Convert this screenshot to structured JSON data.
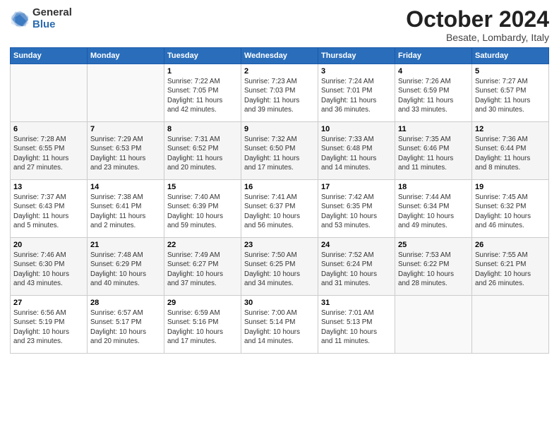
{
  "logo": {
    "general": "General",
    "blue": "Blue"
  },
  "title": "October 2024",
  "subtitle": "Besate, Lombardy, Italy",
  "headers": [
    "Sunday",
    "Monday",
    "Tuesday",
    "Wednesday",
    "Thursday",
    "Friday",
    "Saturday"
  ],
  "weeks": [
    [
      {
        "day": "",
        "info": ""
      },
      {
        "day": "",
        "info": ""
      },
      {
        "day": "1",
        "info": "Sunrise: 7:22 AM\nSunset: 7:05 PM\nDaylight: 11 hours\nand 42 minutes."
      },
      {
        "day": "2",
        "info": "Sunrise: 7:23 AM\nSunset: 7:03 PM\nDaylight: 11 hours\nand 39 minutes."
      },
      {
        "day": "3",
        "info": "Sunrise: 7:24 AM\nSunset: 7:01 PM\nDaylight: 11 hours\nand 36 minutes."
      },
      {
        "day": "4",
        "info": "Sunrise: 7:26 AM\nSunset: 6:59 PM\nDaylight: 11 hours\nand 33 minutes."
      },
      {
        "day": "5",
        "info": "Sunrise: 7:27 AM\nSunset: 6:57 PM\nDaylight: 11 hours\nand 30 minutes."
      }
    ],
    [
      {
        "day": "6",
        "info": "Sunrise: 7:28 AM\nSunset: 6:55 PM\nDaylight: 11 hours\nand 27 minutes."
      },
      {
        "day": "7",
        "info": "Sunrise: 7:29 AM\nSunset: 6:53 PM\nDaylight: 11 hours\nand 23 minutes."
      },
      {
        "day": "8",
        "info": "Sunrise: 7:31 AM\nSunset: 6:52 PM\nDaylight: 11 hours\nand 20 minutes."
      },
      {
        "day": "9",
        "info": "Sunrise: 7:32 AM\nSunset: 6:50 PM\nDaylight: 11 hours\nand 17 minutes."
      },
      {
        "day": "10",
        "info": "Sunrise: 7:33 AM\nSunset: 6:48 PM\nDaylight: 11 hours\nand 14 minutes."
      },
      {
        "day": "11",
        "info": "Sunrise: 7:35 AM\nSunset: 6:46 PM\nDaylight: 11 hours\nand 11 minutes."
      },
      {
        "day": "12",
        "info": "Sunrise: 7:36 AM\nSunset: 6:44 PM\nDaylight: 11 hours\nand 8 minutes."
      }
    ],
    [
      {
        "day": "13",
        "info": "Sunrise: 7:37 AM\nSunset: 6:43 PM\nDaylight: 11 hours\nand 5 minutes."
      },
      {
        "day": "14",
        "info": "Sunrise: 7:38 AM\nSunset: 6:41 PM\nDaylight: 11 hours\nand 2 minutes."
      },
      {
        "day": "15",
        "info": "Sunrise: 7:40 AM\nSunset: 6:39 PM\nDaylight: 10 hours\nand 59 minutes."
      },
      {
        "day": "16",
        "info": "Sunrise: 7:41 AM\nSunset: 6:37 PM\nDaylight: 10 hours\nand 56 minutes."
      },
      {
        "day": "17",
        "info": "Sunrise: 7:42 AM\nSunset: 6:35 PM\nDaylight: 10 hours\nand 53 minutes."
      },
      {
        "day": "18",
        "info": "Sunrise: 7:44 AM\nSunset: 6:34 PM\nDaylight: 10 hours\nand 49 minutes."
      },
      {
        "day": "19",
        "info": "Sunrise: 7:45 AM\nSunset: 6:32 PM\nDaylight: 10 hours\nand 46 minutes."
      }
    ],
    [
      {
        "day": "20",
        "info": "Sunrise: 7:46 AM\nSunset: 6:30 PM\nDaylight: 10 hours\nand 43 minutes."
      },
      {
        "day": "21",
        "info": "Sunrise: 7:48 AM\nSunset: 6:29 PM\nDaylight: 10 hours\nand 40 minutes."
      },
      {
        "day": "22",
        "info": "Sunrise: 7:49 AM\nSunset: 6:27 PM\nDaylight: 10 hours\nand 37 minutes."
      },
      {
        "day": "23",
        "info": "Sunrise: 7:50 AM\nSunset: 6:25 PM\nDaylight: 10 hours\nand 34 minutes."
      },
      {
        "day": "24",
        "info": "Sunrise: 7:52 AM\nSunset: 6:24 PM\nDaylight: 10 hours\nand 31 minutes."
      },
      {
        "day": "25",
        "info": "Sunrise: 7:53 AM\nSunset: 6:22 PM\nDaylight: 10 hours\nand 28 minutes."
      },
      {
        "day": "26",
        "info": "Sunrise: 7:55 AM\nSunset: 6:21 PM\nDaylight: 10 hours\nand 26 minutes."
      }
    ],
    [
      {
        "day": "27",
        "info": "Sunrise: 6:56 AM\nSunset: 5:19 PM\nDaylight: 10 hours\nand 23 minutes."
      },
      {
        "day": "28",
        "info": "Sunrise: 6:57 AM\nSunset: 5:17 PM\nDaylight: 10 hours\nand 20 minutes."
      },
      {
        "day": "29",
        "info": "Sunrise: 6:59 AM\nSunset: 5:16 PM\nDaylight: 10 hours\nand 17 minutes."
      },
      {
        "day": "30",
        "info": "Sunrise: 7:00 AM\nSunset: 5:14 PM\nDaylight: 10 hours\nand 14 minutes."
      },
      {
        "day": "31",
        "info": "Sunrise: 7:01 AM\nSunset: 5:13 PM\nDaylight: 10 hours\nand 11 minutes."
      },
      {
        "day": "",
        "info": ""
      },
      {
        "day": "",
        "info": ""
      }
    ]
  ]
}
